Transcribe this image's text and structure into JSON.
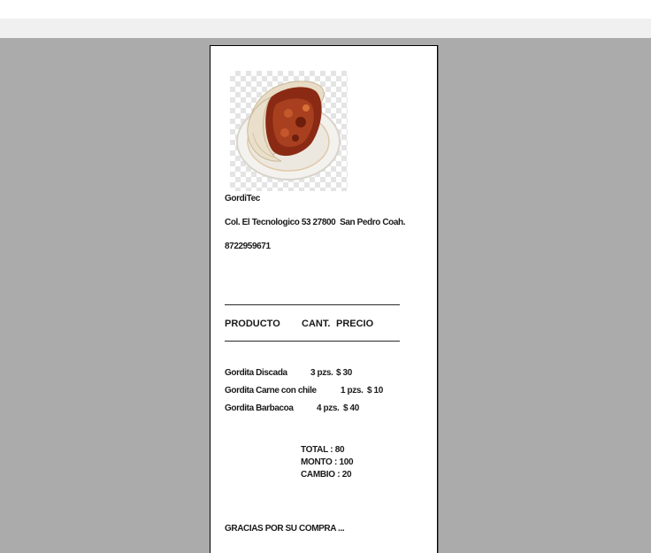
{
  "receipt": {
    "business_name": "GordiTec",
    "address": "Col. El Tecnologico 53 27800  San Pedro Coah.",
    "phone": "8722959671",
    "header": {
      "product": "PRODUCTO",
      "qty": "CANT.",
      "price": "PRECIO"
    },
    "items": [
      {
        "name": "Gordita Discada",
        "qty": "3 pzs.",
        "price": "$ 30"
      },
      {
        "name": "Gordita Carne con chile",
        "qty": "1 pzs.",
        "price": "$ 10"
      },
      {
        "name": "Gordita Barbacoa",
        "qty": "4 pzs.",
        "price": "$ 40"
      }
    ],
    "totals": {
      "total_label": "TOTAL :",
      "total_value": "80",
      "monto_label": "MONTO :",
      "monto_value": "100",
      "cambio_label": "CAMBIO :",
      "cambio_value": "20"
    },
    "footer": "GRACIAS POR SU COMPRA ..."
  },
  "colors": {
    "viewport_background": "#ababab",
    "page_background": "#ffffff",
    "toolbar_strip": "#f0f0f0"
  },
  "icons": {
    "food_image": "gordita-plate-image"
  }
}
